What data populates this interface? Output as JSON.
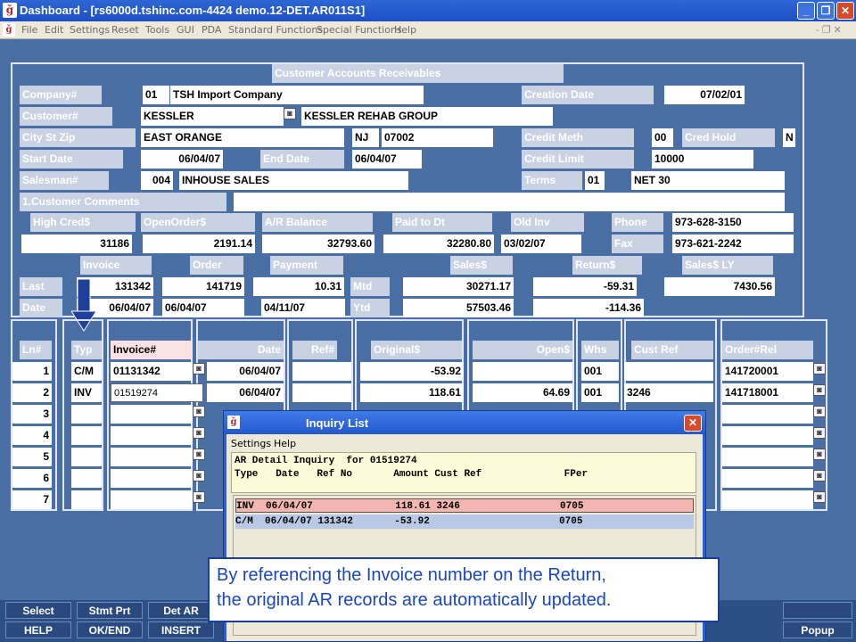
{
  "window": {
    "title": "Dashboard - [rs6000d.tshinc.com-4424 demo.12-DET.AR011S1]",
    "app_icon": "ǧ",
    "min": "_",
    "max": "❐",
    "close": "✕"
  },
  "menu": [
    "File",
    "Edit",
    "Settings",
    "Reset",
    "Tools",
    "GUI",
    "PDA",
    "Standard Functions",
    "Special Functions",
    "Help"
  ],
  "menu_right": "- ❐ ✕",
  "header": {
    "title": "Customer Accounts Receivables",
    "company_label": "Company#",
    "company_no": "01",
    "company_name": "TSH Import Company",
    "creation_label": "Creation Date",
    "creation_date": "07/02/01",
    "customer_label": "Customer#",
    "customer_id": "KESSLER",
    "customer_name": "KESSLER REHAB GROUP",
    "city_label": "City St Zip",
    "city": "EAST ORANGE",
    "state": "NJ",
    "zip": "07002",
    "credit_meth_label": "Credit Meth",
    "credit_meth": "00",
    "cred_hold_label": "Cred Hold",
    "cred_hold": "N",
    "start_label": "Start Date",
    "start_date": "06/04/07",
    "end_label": "End Date",
    "end_date": "06/04/07",
    "credit_limit_label": "Credit Limit",
    "credit_limit": "10000",
    "salesman_label": "Salesman#",
    "salesman_no": "004",
    "salesman_name": "INHOUSE SALES",
    "terms_label": "Terms",
    "terms_code": "01",
    "terms_desc": "NET 30",
    "comments_label": "1.Customer Comments"
  },
  "balances": {
    "high_cred_label": "High Cred$",
    "high_cred": "31186",
    "open_order_label": "OpenOrder$",
    "open_order": "2191.14",
    "ar_balance_label": "A/R Balance",
    "ar_balance": "32793.60",
    "paid_label": "Paid to Dt",
    "paid": "32280.80",
    "old_inv_label": "Old Inv",
    "old_inv": "03/02/07",
    "phone_label": "Phone",
    "phone": "973-628-3150",
    "fax_label": "Fax",
    "fax": "973-621-2242"
  },
  "activity": {
    "invoice_label": "Invoice",
    "order_label": "Order",
    "payment_label": "Payment",
    "sales_label": "Sales$",
    "return_label": "Return$",
    "sales_ly_label": "Sales$ LY",
    "last_label": "Last",
    "date_label": "Date",
    "mtd_label": "Mtd",
    "ytd_label": "Ytd",
    "last_invoice": "131342",
    "last_order": "141719",
    "last_payment": "10.31",
    "date_invoice": "06/04/07",
    "date_order": "06/04/07",
    "date_payment": "04/11/07",
    "mtd_sales": "30271.17",
    "mtd_return": "-59.31",
    "sales_ly": "7430.56",
    "ytd_sales": "57503.46",
    "ytd_return": "-114.36"
  },
  "grid": {
    "headers": {
      "ln": "Ln#",
      "typ": "Typ",
      "invoice": "Invoice#",
      "date": "Date",
      "ref": "Ref#",
      "original": "Original$",
      "open": "Open$",
      "whs": "Whs",
      "cust_ref": "Cust Ref",
      "order_rel": "Order#Rel"
    },
    "rows": [
      {
        "ln": "1",
        "typ": "C/M",
        "invoice": "01131342",
        "date": "06/04/07",
        "ref": "",
        "original": "-53.92",
        "open": "",
        "whs": "001",
        "cust_ref": "",
        "order_rel": "141720001"
      },
      {
        "ln": "2",
        "typ": "INV",
        "invoice": "01519274",
        "date": "06/04/07",
        "ref": "",
        "original": "118.61",
        "open": "64.69",
        "whs": "001",
        "cust_ref": "3246",
        "order_rel": "141718001"
      },
      {
        "ln": "3"
      },
      {
        "ln": "4"
      },
      {
        "ln": "5"
      },
      {
        "ln": "6"
      },
      {
        "ln": "7"
      }
    ]
  },
  "dialog": {
    "title": "Inquiry List",
    "menu": [
      "Settings",
      "Help"
    ],
    "header_line1": "AR Detail Inquiry  for 01519274",
    "header_line2": "Type   Date   Ref No       Amount Cust Ref              FPer",
    "rows": [
      "INV  06/04/07              118.61 3246                 0705",
      "C/M  06/04/07 131342       -53.92                      0705"
    ]
  },
  "callout": {
    "line1": "By referencing the Invoice number on the Return,",
    "line2": "the original AR records are automatically updated."
  },
  "fkeys": {
    "select": "Select",
    "stmt_prt": "Stmt Prt",
    "det_ar": "Det AR",
    "help": "HELP",
    "okend": "OK/END",
    "insert": "INSERT",
    "popup": "Popup"
  },
  "colors": {
    "background": "#4a6fa5",
    "label_bg": "#c9d2e2",
    "highlight_row": "#f4b6b0",
    "selected_row": "#b8c9e6",
    "callout_text": "#1a46c4"
  }
}
